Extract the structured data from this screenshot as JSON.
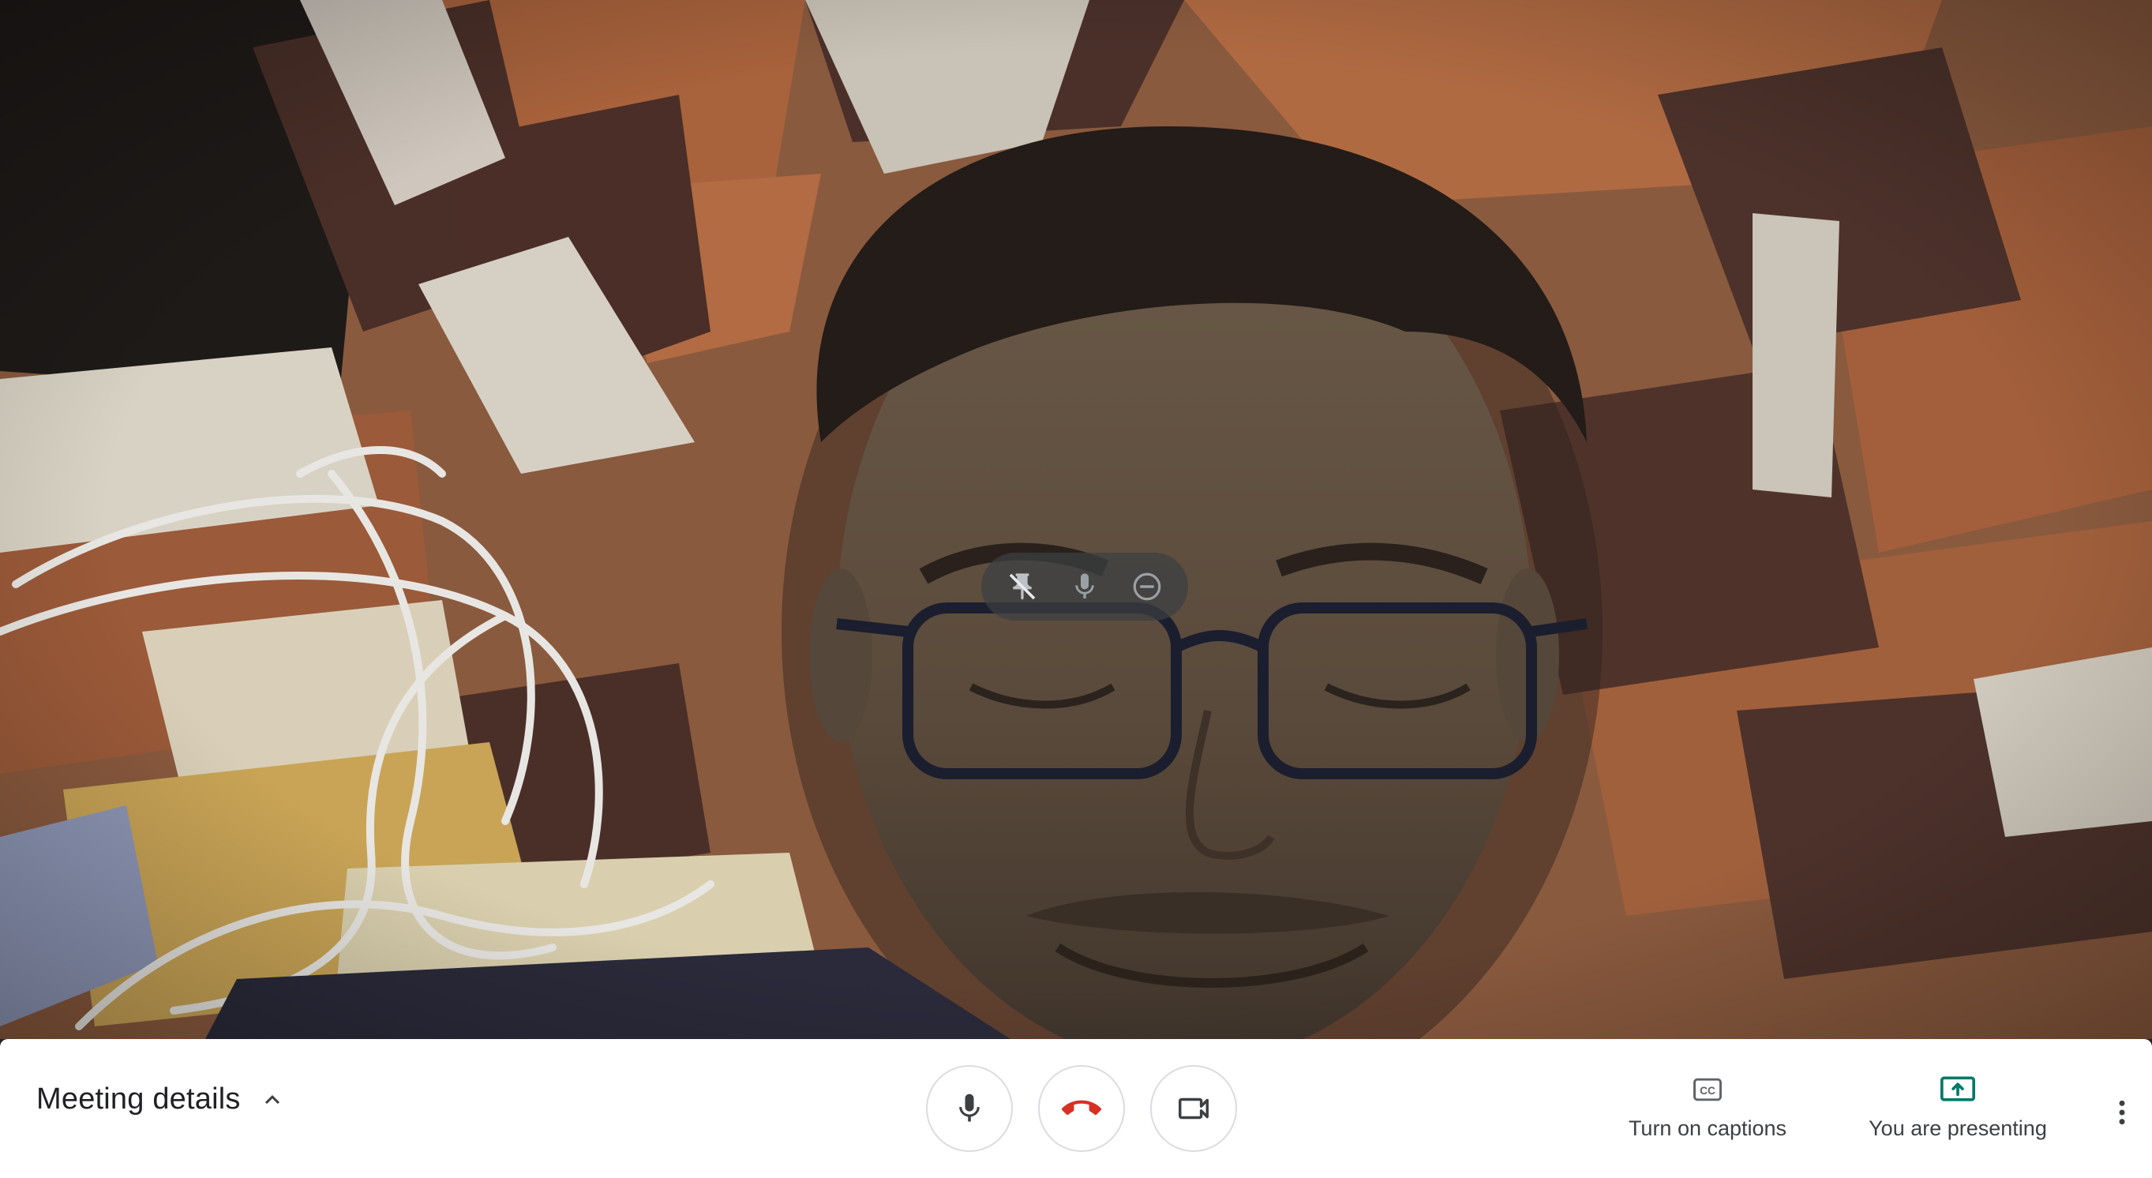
{
  "tile_controls": {
    "pin_icon": "pin-off-icon",
    "mic_icon": "microphone-icon",
    "remove_icon": "remove-circle-icon"
  },
  "bottom_bar": {
    "meeting_details_label": "Meeting details",
    "meeting_details_icon": "chevron-up-icon",
    "mic_icon": "microphone-icon",
    "leave_icon": "hang-up-icon",
    "camera_icon": "video-camera-icon",
    "captions_label": "Turn on captions",
    "captions_icon": "closed-captions-icon",
    "presenting_label": "You are presenting",
    "presenting_icon": "present-screen-icon",
    "more_icon": "more-vertical-icon"
  },
  "colors": {
    "leave_red": "#d93025",
    "present_green": "#00796b",
    "icon_gray": "#5f6368",
    "text_dark": "#202124"
  }
}
